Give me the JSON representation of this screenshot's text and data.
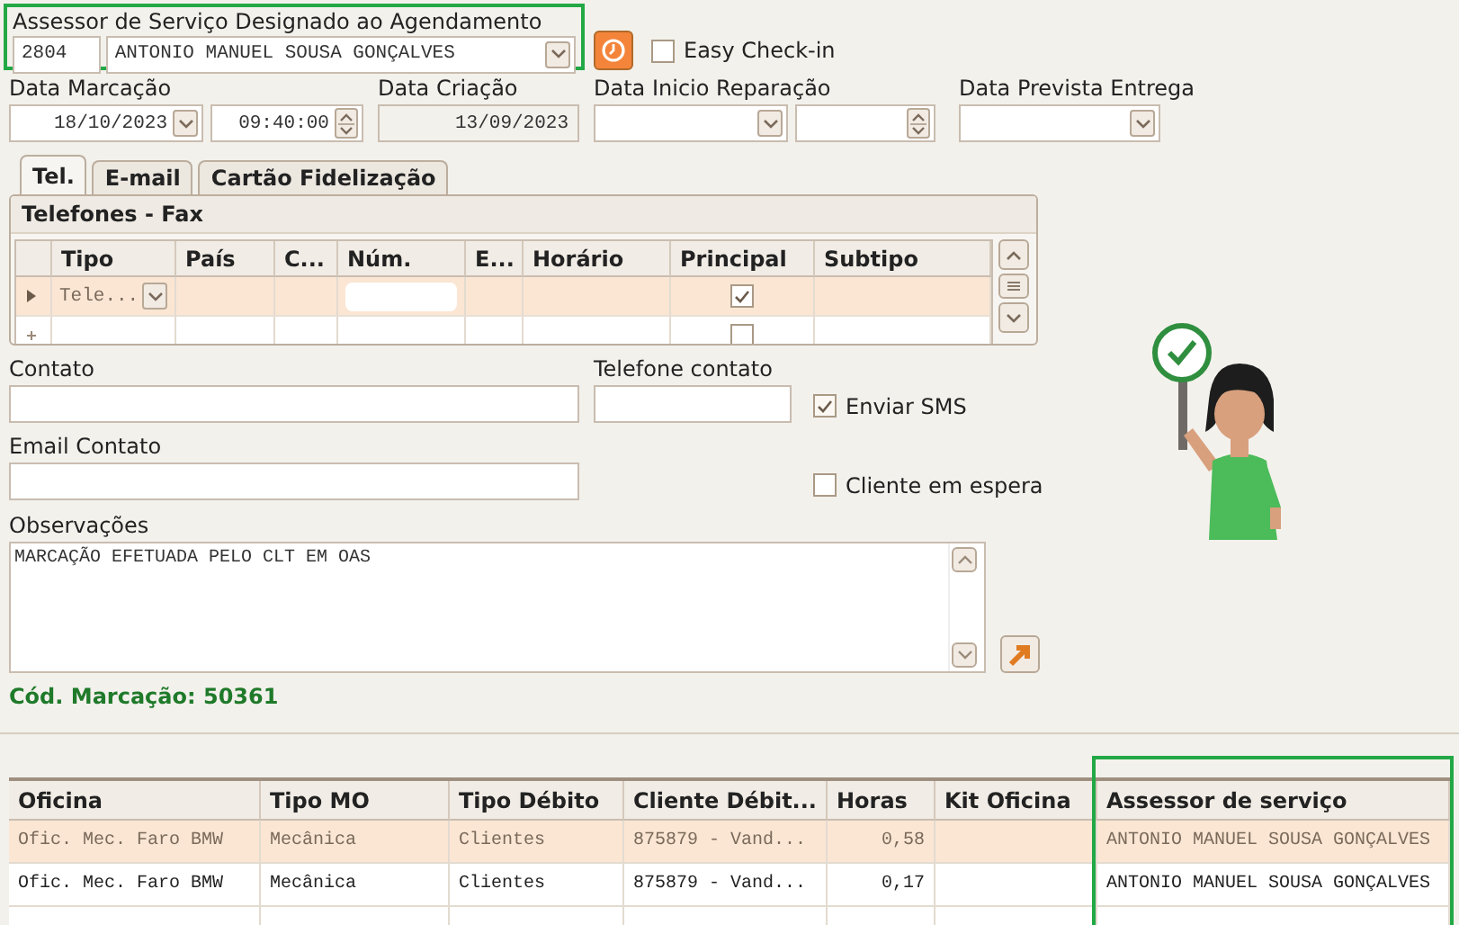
{
  "assigned_advisor": {
    "label": "Assessor de Serviço Designado ao Agendamento",
    "code": "2804",
    "name": "ANTONIO MANUEL SOUSA GONÇALVES",
    "highlighted": true
  },
  "easy_checkin": {
    "label": "Easy Check-in",
    "checked": false
  },
  "dates": [
    {
      "label": "Data Marcação",
      "fields": [
        {
          "kind": "date",
          "value": "18/10/2023"
        },
        {
          "kind": "time",
          "value": "09:40:00"
        }
      ]
    },
    {
      "label": "Data Criação",
      "fields": [
        {
          "kind": "readonly",
          "value": "13/09/2023"
        }
      ]
    },
    {
      "label": "Data Inicio Reparação",
      "fields": [
        {
          "kind": "date"
        },
        {
          "kind": "time"
        }
      ]
    },
    {
      "label": "Data Prevista Entrega",
      "fields": [
        {
          "kind": "date"
        }
      ]
    }
  ],
  "tabs": [
    {
      "label": "Tel.",
      "selected": true
    },
    {
      "label": "E-mail",
      "selected": false
    },
    {
      "label": "Cartão Fidelização",
      "selected": false
    }
  ],
  "phones": {
    "title": "Telefones - Fax",
    "columns": [
      "Tipo",
      "País",
      "C...",
      "Núm.",
      "E...",
      "Horário",
      "Principal",
      "Subtipo"
    ],
    "rows": [
      {
        "kind": "record",
        "selected": true,
        "tipo": "Tele...",
        "principal": true
      },
      {
        "kind": "new",
        "selected": false,
        "principal": false
      }
    ]
  },
  "contact": {
    "fields": [
      {
        "label": "Contato",
        "kind": "wide"
      },
      {
        "label": "Telefone contato",
        "kind": "narrow"
      },
      {
        "label": "Email Contato",
        "kind": "wide"
      }
    ],
    "options": [
      {
        "label": "Enviar SMS",
        "checked": true
      },
      {
        "label": "Cliente em espera",
        "checked": false
      }
    ]
  },
  "observations": {
    "label": "Observações",
    "value": "MARCAÇÃO EFETUADA PELO CLT EM OAS"
  },
  "booking_code": "Cód. Marcação: 50361",
  "services": {
    "columns": [
      {
        "label": "Oficina",
        "kind": "text"
      },
      {
        "label": "Tipo MO",
        "kind": "text"
      },
      {
        "label": "Tipo Débito",
        "kind": "text"
      },
      {
        "label": "Cliente Débit...",
        "kind": "text"
      },
      {
        "label": "Horas",
        "kind": "number"
      },
      {
        "label": "Kit Oficina",
        "kind": "text"
      },
      {
        "label": "Assessor de serviço",
        "kind": "text",
        "highlighted": true
      }
    ],
    "rows": [
      {
        "selected": true,
        "cells": [
          "Ofic. Mec. Faro BMW",
          "Mecânica",
          "Clientes",
          "875879 - Vand...",
          "0,58",
          "",
          "ANTONIO MANUEL SOUSA GONÇALVES"
        ]
      },
      {
        "selected": false,
        "cells": [
          "Ofic. Mec. Faro BMW",
          "Mecânica",
          "Clientes",
          "875879 - Vand...",
          "0,17",
          "",
          "ANTONIO MANUEL SOUSA GONÇALVES"
        ]
      }
    ]
  }
}
